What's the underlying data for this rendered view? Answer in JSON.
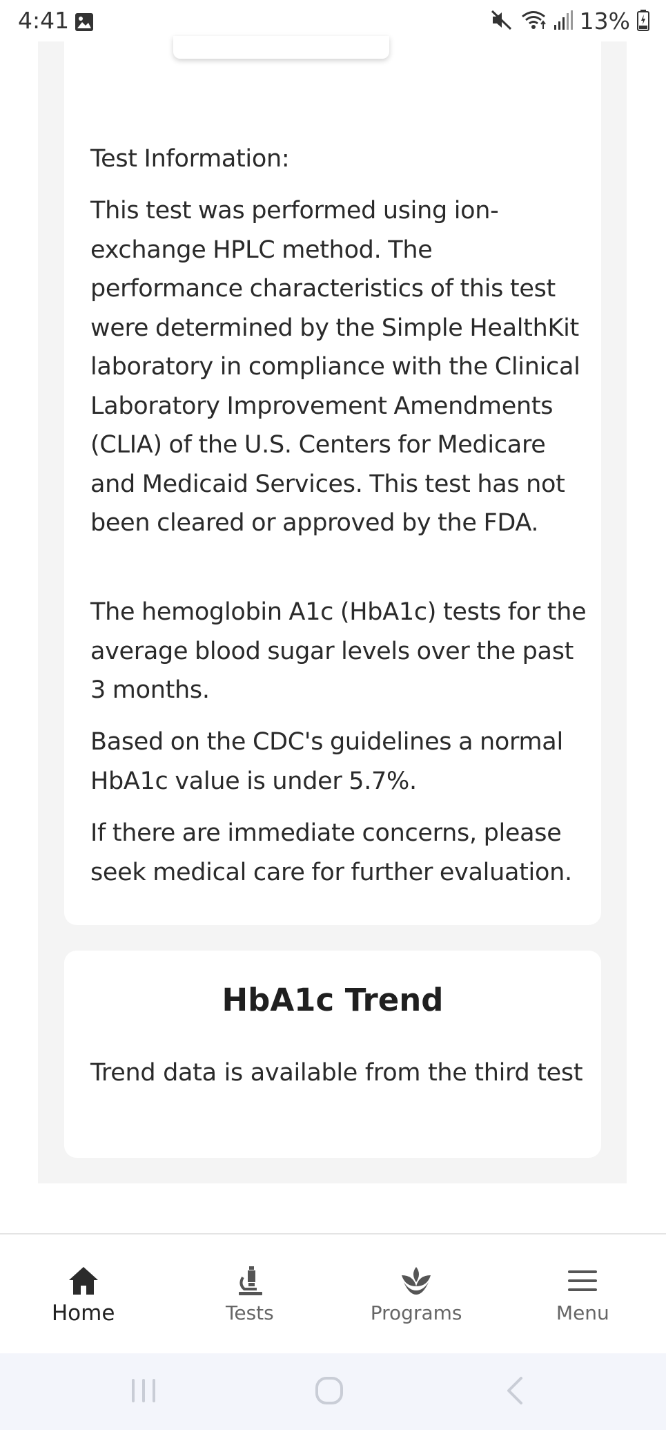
{
  "status_bar": {
    "time": "4:41",
    "battery": "13%",
    "icons": [
      "gallery-icon",
      "mute-icon",
      "wifi-icon",
      "signal-icon",
      "battery-icon"
    ]
  },
  "test_info": {
    "heading": "Test Information:",
    "paragraphs": [
      "This test was performed using ion-exchange HPLC method. The performance characteristics of this test were determined by the Simple HealthKit laboratory in compliance with the Clinical Laboratory Improvement Amendments (CLIA) of the U.S. Centers for Medicare and Medicaid Services. This test has not been cleared or approved by the FDA.",
      "The hemoglobin A1c (HbA1c) tests for the average blood sugar levels over the past 3 months.",
      "Based on the CDC's guidelines a normal HbA1c value is under 5.7%.",
      "If there are immediate concerns, please seek medical care for further evaluation."
    ]
  },
  "trend": {
    "title": "HbA1c Trend",
    "message": "Trend data is available from the third test"
  },
  "bottom_nav": {
    "active": "Home",
    "items": [
      {
        "label": "Home",
        "icon": "home-icon"
      },
      {
        "label": "Tests",
        "icon": "microscope-icon"
      },
      {
        "label": "Programs",
        "icon": "lotus-icon"
      },
      {
        "label": "Menu",
        "icon": "hamburger-menu-icon"
      }
    ]
  },
  "system_nav": {
    "buttons": [
      "recents-icon",
      "home-circle-icon",
      "back-icon"
    ]
  },
  "colors": {
    "panel_gray": "#f4f4f4",
    "active_nav": "#222222",
    "inactive_nav": "#666666",
    "system_nav_bg": "#f3f5fb"
  }
}
